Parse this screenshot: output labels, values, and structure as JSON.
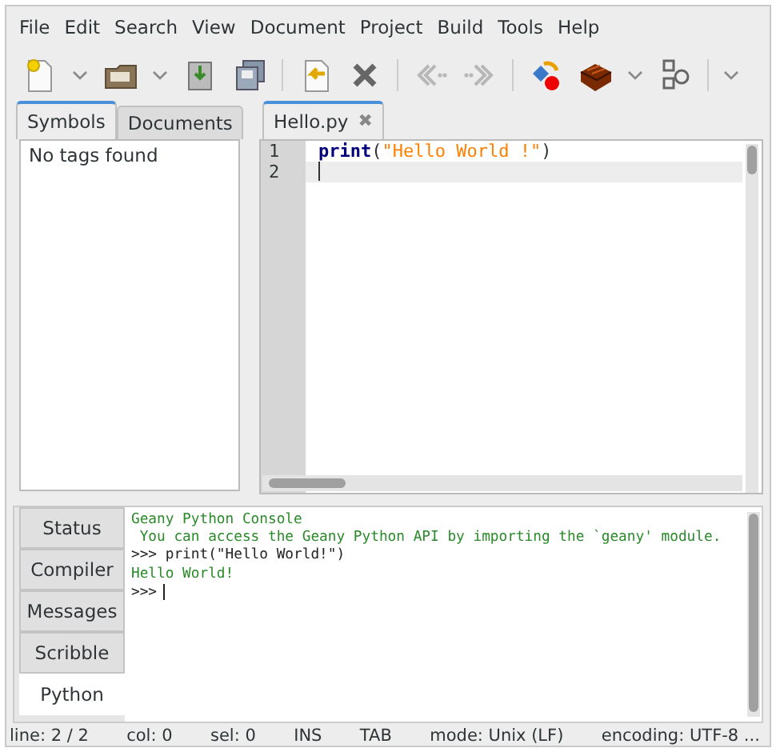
{
  "menu": [
    "File",
    "Edit",
    "Search",
    "View",
    "Document",
    "Project",
    "Build",
    "Tools",
    "Help"
  ],
  "toolbar": [
    {
      "kind": "button",
      "disabled": false
    },
    {
      "kind": "caret"
    },
    {
      "kind": "button",
      "disabled": false
    },
    {
      "kind": "caret"
    },
    {
      "kind": "button",
      "disabled": false
    },
    {
      "kind": "button",
      "disabled": false
    },
    {
      "kind": "separator"
    },
    {
      "kind": "button",
      "disabled": false
    },
    {
      "kind": "button",
      "disabled": false
    },
    {
      "kind": "separator"
    },
    {
      "kind": "button",
      "disabled": true
    },
    {
      "kind": "button",
      "disabled": true
    },
    {
      "kind": "separator"
    },
    {
      "kind": "button",
      "disabled": false
    },
    {
      "kind": "button",
      "disabled": false
    },
    {
      "kind": "caret"
    },
    {
      "kind": "button",
      "disabled": false
    },
    {
      "kind": "separator"
    },
    {
      "kind": "caret"
    }
  ],
  "sidebar": {
    "tabs": [
      {
        "label": "Symbols",
        "selected": true
      },
      {
        "label": "Documents",
        "selected": false
      }
    ],
    "message": "No tags found"
  },
  "editor": {
    "tabs": [
      {
        "label": "Hello.py",
        "selected": true,
        "close": "✖"
      }
    ],
    "lines": [
      {
        "number": "1",
        "current": false,
        "tokens": [
          {
            "kind": "keyword",
            "text": "print"
          },
          {
            "kind": "plain",
            "text": "("
          },
          {
            "kind": "string",
            "text": "\"Hello World !\""
          },
          {
            "kind": "plain",
            "text": ")"
          }
        ]
      },
      {
        "number": "2",
        "current": true
      }
    ]
  },
  "panel": {
    "tabs": [
      {
        "label": "Status",
        "selected": false
      },
      {
        "label": "Compiler",
        "selected": false
      },
      {
        "label": "Messages",
        "selected": false
      },
      {
        "label": "Scribble",
        "selected": false
      },
      {
        "label": "Python",
        "selected": true
      }
    ],
    "console": [
      {
        "kind": "output",
        "text": "Geany Python Console"
      },
      {
        "kind": "output",
        "text": " You can access the Geany Python API by importing the `geany' module."
      },
      {
        "kind": "input",
        "text": ">>> print(\"Hello World!\")"
      },
      {
        "kind": "output",
        "text": "Hello World!"
      },
      {
        "kind": "prompt",
        "text": ">>>"
      }
    ]
  },
  "status_bar": [
    "line: 2 / 2",
    "col: 0",
    "sel: 0",
    "INS",
    "TAB",
    "mode: Unix (LF)",
    "encoding: UTF-8 ..."
  ]
}
